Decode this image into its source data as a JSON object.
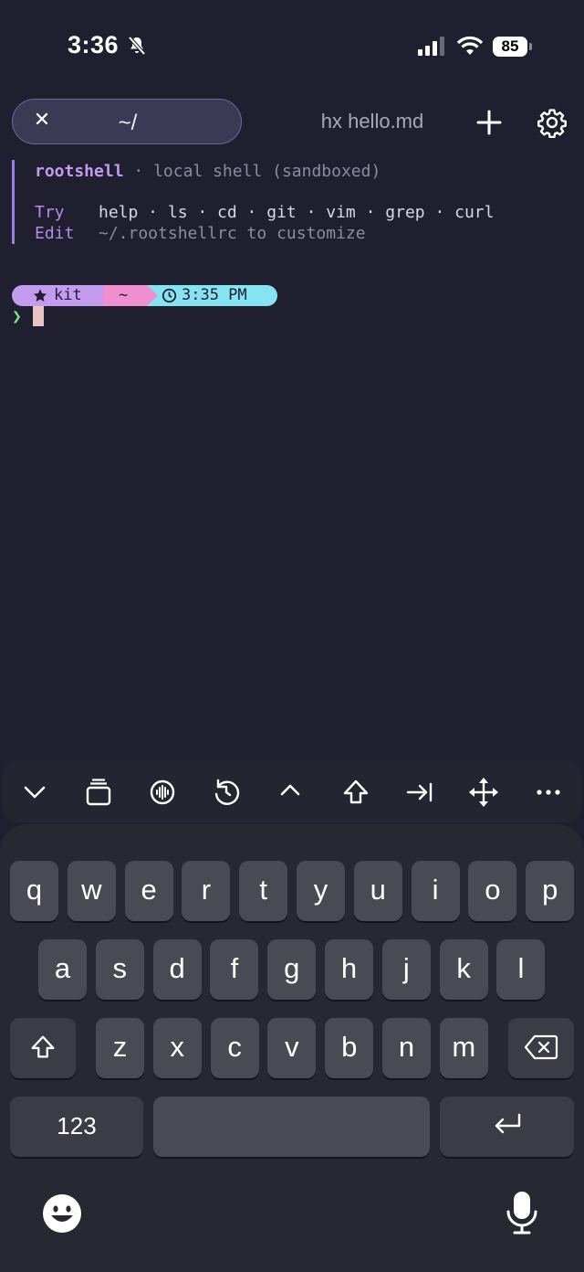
{
  "status_bar": {
    "time": "3:36",
    "battery": "85"
  },
  "tabs": [
    {
      "label": "~/",
      "active": true
    },
    {
      "label": "hx hello.md",
      "active": false
    }
  ],
  "icons": {
    "close": "close-icon",
    "new_tab": "plus-icon",
    "settings": "gear-icon"
  },
  "welcome": {
    "brand": "rootshell",
    "separator": " · ",
    "subtitle": "local shell (sandboxed)",
    "try_label": "Try",
    "try_commands": "help · ls · cd · git · vim · grep · curl",
    "edit_label": "Edit",
    "edit_text": "~/.rootshellrc to customize"
  },
  "prompt": {
    "user": "kit",
    "dir": "~",
    "time": "3:35 PM",
    "symbol": "❯"
  },
  "toolbar": [
    "chevron-down-icon",
    "tabs-stack-icon",
    "audio-wave-icon",
    "history-icon",
    "caret-up-icon",
    "shift-arrow-icon",
    "tab-arrow-icon",
    "move-arrows-icon",
    "more-icon"
  ],
  "keyboard": {
    "row1": [
      "q",
      "w",
      "e",
      "r",
      "t",
      "y",
      "u",
      "i",
      "o",
      "p"
    ],
    "row2": [
      "a",
      "s",
      "d",
      "f",
      "g",
      "h",
      "j",
      "k",
      "l"
    ],
    "row3": [
      "z",
      "x",
      "c",
      "v",
      "b",
      "n",
      "m"
    ],
    "numbers_key": "123"
  },
  "colors": {
    "background": "#1f1f2f",
    "accent_purple": "#c39cf0",
    "accent_pink": "#f08fcf",
    "accent_cyan": "#86e3f2",
    "prompt_green": "#7fe08a"
  }
}
